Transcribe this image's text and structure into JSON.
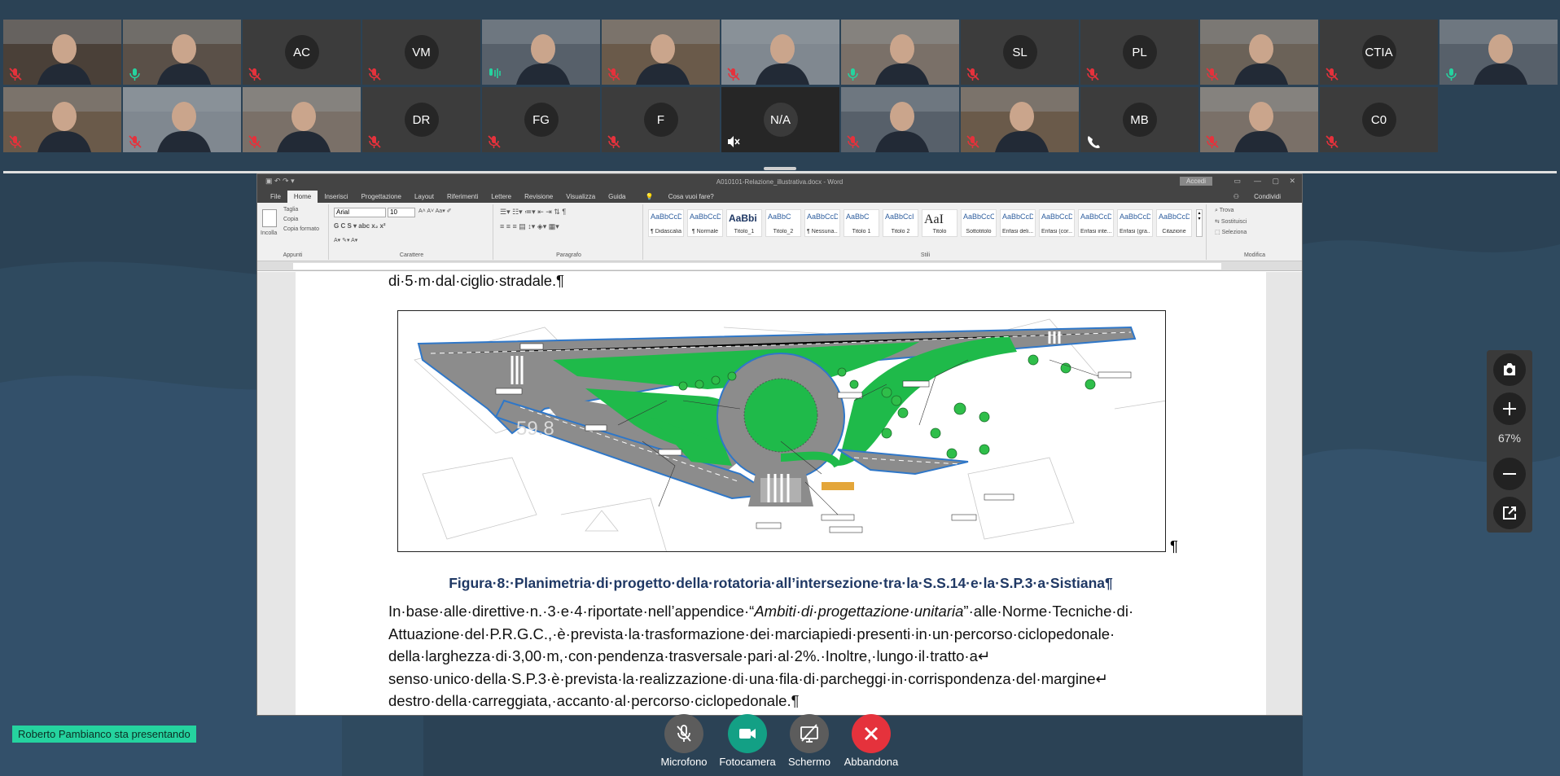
{
  "participants": [
    {
      "initials": "",
      "video": true,
      "mic": "muted"
    },
    {
      "initials": "",
      "video": true,
      "mic": "on"
    },
    {
      "initials": "AC",
      "video": false,
      "mic": "muted"
    },
    {
      "initials": "VM",
      "video": false,
      "mic": "muted"
    },
    {
      "initials": "",
      "video": true,
      "mic": "speaking",
      "active": true
    },
    {
      "initials": "",
      "video": true,
      "mic": "muted"
    },
    {
      "initials": "",
      "video": true,
      "mic": "muted"
    },
    {
      "initials": "",
      "video": true,
      "mic": "on"
    },
    {
      "initials": "SL",
      "video": false,
      "mic": "muted"
    },
    {
      "initials": "PL",
      "video": false,
      "mic": "muted"
    },
    {
      "initials": "",
      "video": true,
      "mic": "muted"
    },
    {
      "initials": "CTIA",
      "video": false,
      "mic": "muted"
    },
    {
      "initials": "",
      "video": true,
      "mic": "on"
    },
    {
      "initials": "",
      "video": true,
      "mic": "muted"
    },
    {
      "initials": "",
      "video": true,
      "mic": "muted"
    },
    {
      "initials": "",
      "video": true,
      "mic": "muted"
    },
    {
      "initials": "DR",
      "video": false,
      "mic": "muted"
    },
    {
      "initials": "FG",
      "video": false,
      "mic": "muted"
    },
    {
      "initials": "F",
      "video": false,
      "mic": "muted"
    },
    {
      "initials": "N/A",
      "video": false,
      "mic": "speaker-off",
      "dark": true
    },
    {
      "initials": "",
      "video": true,
      "mic": "muted"
    },
    {
      "initials": "",
      "video": true,
      "mic": "muted"
    },
    {
      "initials": "MB",
      "video": false,
      "mic": "phone"
    },
    {
      "initials": "",
      "video": true,
      "mic": "muted"
    },
    {
      "initials": "C0",
      "video": false,
      "mic": "muted"
    }
  ],
  "word": {
    "title": "A010101-Relazione_illustrativa.docx  -  Word",
    "access": "Accedi",
    "tabs": [
      "File",
      "Home",
      "Inserisci",
      "Progettazione",
      "Layout",
      "Riferimenti",
      "Lettere",
      "Revisione",
      "Visualizza",
      "Guida"
    ],
    "tell_me": "Cosa vuoi fare?",
    "share": "Condividi",
    "clipboard": {
      "paste": "Incolla",
      "cut": "Taglia",
      "copy": "Copia",
      "format": "Copia formato",
      "label": "Appunti"
    },
    "font": {
      "name": "Arial",
      "size": "10",
      "label": "Carattere"
    },
    "paragraph_label": "Paragrafo",
    "styles_label": "Stili",
    "styles": [
      {
        "preview": "AaBbCcDdi",
        "name": "¶ Didascalia"
      },
      {
        "preview": "AaBbCcDc",
        "name": "¶ Normale"
      },
      {
        "preview": "AaBbi",
        "name": "Titolo_1"
      },
      {
        "preview": "AaBbC",
        "name": "Titolo_2"
      },
      {
        "preview": "AaBbCcDc",
        "name": "¶ Nessuna..."
      },
      {
        "preview": "AaBbC",
        "name": "Titolo 1"
      },
      {
        "preview": "AaBbCcI",
        "name": "Titolo 2"
      },
      {
        "preview": "AaI",
        "name": "Titolo"
      },
      {
        "preview": "AaBbCcC",
        "name": "Sottotitolo"
      },
      {
        "preview": "AaBbCcDc",
        "name": "Enfasi deli..."
      },
      {
        "preview": "AaBbCcDc",
        "name": "Enfasi (cor..."
      },
      {
        "preview": "AaBbCcDc",
        "name": "Enfasi inte..."
      },
      {
        "preview": "AaBbCcDc",
        "name": "Enfasi (gra..."
      },
      {
        "preview": "AaBbCcDc",
        "name": "Citazione"
      }
    ],
    "editing": {
      "find": "Trova",
      "replace": "Sostituisci",
      "select": "Seleziona",
      "label": "Modifica"
    }
  },
  "document": {
    "line_top": "di·5·m·dal·ciglio·stradale.¶",
    "figure_pilcrow": "¶",
    "caption": "Figura·8:·Planimetria·di·progetto·della·rotatoria·all’intersezione·tra·la·S.S.14·e·la·S.P.3·a·Sistiana¶",
    "para_lines": [
      {
        "pre": "In·base·alle·direttive·n.·3·e·4·riportate·nell’appendice·“",
        "em": "Ambiti·di·progettazione·unitaria",
        "post": "”·alle·Norme·Tecniche·di·"
      },
      {
        "pre": "Attuazione·del·P.R.G.C.,·è·prevista·la·trasformazione·dei·marciapiedi·presenti·in·un·percorso·ciclopedonale·",
        "em": "",
        "post": ""
      },
      {
        "pre": "della·larghezza·di·3,00·m,·con·pendenza·trasversale·pari·al·2%.·Inoltre,·lungo·il·tratto·a↵",
        "em": "",
        "post": ""
      },
      {
        "pre": "senso·unico·della·S.P.3·è·prevista·la·realizzazione·di·una·fila·di·parcheggi·in·corrispondenza·del·margine↵",
        "em": "",
        "post": ""
      },
      {
        "pre": "destro·della·carreggiata,·accanto·al·percorso·ciclopedonale.¶",
        "em": "",
        "post": ""
      }
    ],
    "plan_marks": [
      "59.8"
    ]
  },
  "viewer": {
    "zoom": "67%"
  },
  "presenter_banner": "Roberto Pambianco sta presentando",
  "controls": [
    {
      "label": "Microfono",
      "color": "#5c5c5c",
      "icon": "mic-off-icon"
    },
    {
      "label": "Fotocamera",
      "color": "#13a085",
      "icon": "camera-icon"
    },
    {
      "label": "Schermo",
      "color": "#5c5c5c",
      "icon": "screen-share-off-icon"
    },
    {
      "label": "Abbandona",
      "color": "#e5323c",
      "icon": "close-icon"
    }
  ],
  "colors": {
    "accent": "#25d39f",
    "background": "#2b4255",
    "tile": "#3c3c3c",
    "leave": "#e5323c"
  }
}
